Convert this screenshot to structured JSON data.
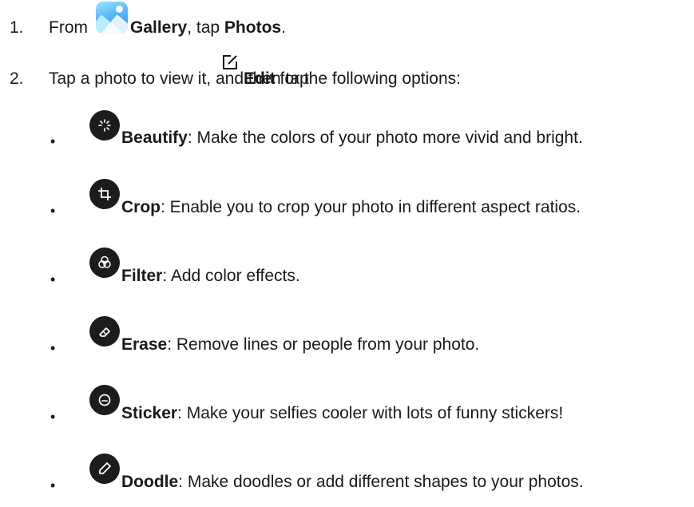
{
  "steps": [
    {
      "number": "1.",
      "parts": [
        "From ",
        "Gallery",
        ", tap ",
        "Photos",
        "."
      ],
      "icon": "gallery-app-icon"
    },
    {
      "number": "2.",
      "parts": [
        "Tap a photo to view it, and then tap ",
        "Edit",
        " for the following options:"
      ],
      "icon": "edit-icon"
    }
  ],
  "options": [
    {
      "icon": "beautify-icon",
      "title": "Beautify",
      "description": ": Make the colors of your photo more vivid and bright."
    },
    {
      "icon": "crop-icon",
      "title": "Crop",
      "description": ": Enable you to crop your photo in different aspect ratios."
    },
    {
      "icon": "filter-icon",
      "title": "Filter",
      "description": ": Add color effects."
    },
    {
      "icon": "erase-icon",
      "title": "Erase",
      "description": ": Remove lines or people from your photo."
    },
    {
      "icon": "sticker-icon",
      "title": "Sticker",
      "description": ": Make your selfies cooler with lots of funny stickers!"
    },
    {
      "icon": "doodle-icon",
      "title": "Doodle",
      "description": ": Make doodles or add different shapes to your photos."
    }
  ],
  "bullet_char": "•",
  "colors": {
    "text": "#1a1a1a",
    "icon_bg": "#1c1c1c",
    "gallery_blue": "#57b6f5"
  }
}
